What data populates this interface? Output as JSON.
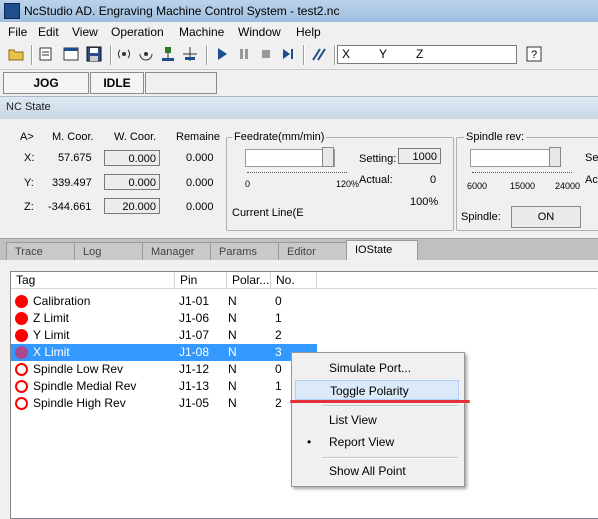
{
  "window": {
    "title": "NcStudio AD. Engraving Machine Control System  - test2.nc"
  },
  "menu": [
    "File",
    "Edit",
    "View",
    "Operation",
    "Machine",
    "Window",
    "Help"
  ],
  "toolbar": {
    "axes": [
      "X",
      "Y",
      "Z"
    ]
  },
  "status": {
    "mode": "JOG",
    "state": "IDLE"
  },
  "ncstate": {
    "header": "NC State",
    "columns": {
      "axis": "A>",
      "mcoor": "M. Coor.",
      "wcoor": "W. Coor.",
      "remain": "Remaine"
    },
    "rows": [
      {
        "axis": "X:",
        "mcoor": "57.675",
        "wcoor": "0.000",
        "remain": "0.000"
      },
      {
        "axis": "Y:",
        "mcoor": "339.497",
        "wcoor": "0.000",
        "remain": "0.000"
      },
      {
        "axis": "Z:",
        "mcoor": "-344.661",
        "wcoor": "20.000",
        "remain": "0.000"
      }
    ],
    "feedrate": {
      "title": "Feedrate(mm/min)",
      "min": "0",
      "max": "120%",
      "setting_label": "Setting:",
      "setting": "1000",
      "actual_label": "Actual:",
      "actual": "0",
      "percent": "100%",
      "current_line": "Current Line(E"
    },
    "spindle": {
      "title": "Spindle rev:",
      "ticks": [
        "6000",
        "15000",
        "24000"
      ],
      "set_label": "Set",
      "act_label": "Ac",
      "spindle_label": "Spindle:",
      "button": "ON"
    }
  },
  "tabs": [
    "Trace",
    "Log",
    "Manager",
    "Params",
    "Editor",
    "IOState"
  ],
  "active_tab": "IOState",
  "io": {
    "headers": [
      "Tag",
      "Pin",
      "Polar...",
      "No."
    ],
    "rows": [
      {
        "tag": "Calibration",
        "pin": "J1-01",
        "polarity": "N",
        "no": "0",
        "icon": "filled"
      },
      {
        "tag": "Z Limit",
        "pin": "J1-06",
        "polarity": "N",
        "no": "1",
        "icon": "filled"
      },
      {
        "tag": "Y Limit",
        "pin": "J1-07",
        "polarity": "N",
        "no": "2",
        "icon": "filled"
      },
      {
        "tag": "X Limit",
        "pin": "J1-08",
        "polarity": "N",
        "no": "3",
        "icon": "selfill"
      },
      {
        "tag": "Spindle Low Rev",
        "pin": "J1-12",
        "polarity": "N",
        "no": "0",
        "icon": "hollow"
      },
      {
        "tag": "Spindle Medial Rev",
        "pin": "J1-13",
        "polarity": "N",
        "no": "1",
        "icon": "hollow"
      },
      {
        "tag": "Spindle High Rev",
        "pin": "J1-05",
        "polarity": "N",
        "no": "2",
        "icon": "hollow"
      }
    ]
  },
  "context_menu": {
    "simulate": "Simulate Port...",
    "toggle": "Toggle Polarity",
    "list_view": "List View",
    "report_view": "Report View",
    "show_all": "Show All Point",
    "bullet": "•"
  },
  "colors": {
    "selection": "#3399ff",
    "led": "#ff0000",
    "highlight_line": "#e3313a"
  }
}
